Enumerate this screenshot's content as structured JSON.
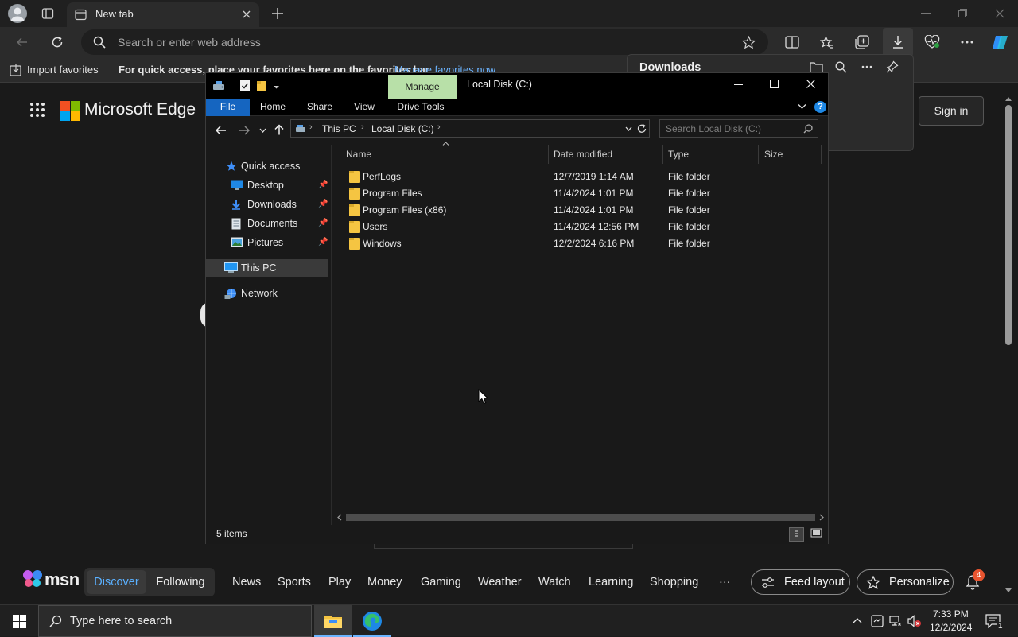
{
  "browser": {
    "tab_title": "New tab",
    "address_placeholder": "Search or enter web address",
    "favorites": {
      "import_label": "Import favorites",
      "hint_text": "For quick access, place your favorites here on the favorites bar.",
      "manage_link": "Manage favorites now"
    },
    "downloads_flyout": {
      "title": "Downloads"
    },
    "page": {
      "brand": "Microsoft Edge",
      "sign_in": "Sign in"
    }
  },
  "explorer": {
    "window_title": "Local Disk (C:)",
    "ribbon_context_group": "Manage",
    "ribbon_tabs": [
      "File",
      "Home",
      "Share",
      "View",
      "Drive Tools"
    ],
    "breadcrumb": [
      "This PC",
      "Local Disk (C:)"
    ],
    "search_placeholder": "Search Local Disk (C:)",
    "nav_pane": {
      "quick_access": "Quick access",
      "pinned": [
        "Desktop",
        "Downloads",
        "Documents",
        "Pictures"
      ],
      "this_pc": "This PC",
      "network": "Network"
    },
    "columns": [
      "Name",
      "Date modified",
      "Type",
      "Size"
    ],
    "files": [
      {
        "name": "PerfLogs",
        "modified": "12/7/2019 1:14 AM",
        "type": "File folder",
        "size": ""
      },
      {
        "name": "Program Files",
        "modified": "11/4/2024 1:01 PM",
        "type": "File folder",
        "size": ""
      },
      {
        "name": "Program Files (x86)",
        "modified": "11/4/2024 1:01 PM",
        "type": "File folder",
        "size": ""
      },
      {
        "name": "Users",
        "modified": "11/4/2024 12:56 PM",
        "type": "File folder",
        "size": ""
      },
      {
        "name": "Windows",
        "modified": "12/2/2024 6:16 PM",
        "type": "File folder",
        "size": ""
      }
    ],
    "status": "5 items",
    "colors": {
      "file_tab": "#1565c0",
      "manage_tab": "#b8e0a8",
      "folder": "#f5c542"
    }
  },
  "msn": {
    "logo_text": "msn",
    "nav": [
      "Discover",
      "Following",
      "News",
      "Sports",
      "Play",
      "Money",
      "Gaming",
      "Weather",
      "Watch",
      "Learning",
      "Shopping"
    ],
    "more": "···",
    "feed_layout": "Feed layout",
    "personalize": "Personalize",
    "notification_count": "4"
  },
  "taskbar": {
    "search_placeholder": "Type here to search",
    "time": "7:33 PM",
    "date": "12/2/2024",
    "notification_count": "1"
  }
}
